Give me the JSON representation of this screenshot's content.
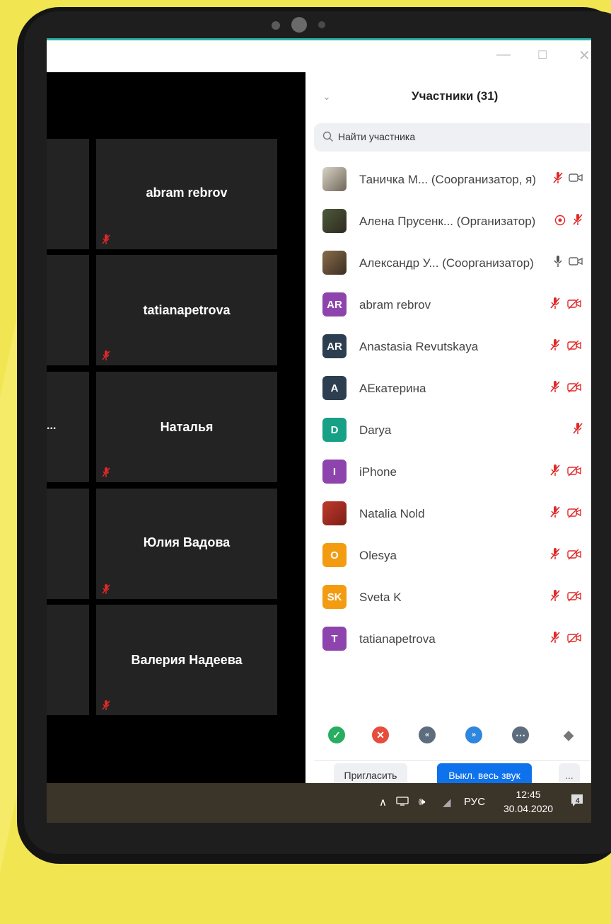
{
  "panel": {
    "title": "Участники (31)",
    "search_placeholder": "Найти участника"
  },
  "video_tiles": [
    {
      "name": "abram rebrov"
    },
    {
      "name": "tatianapetrova"
    },
    {
      "name": "Наталья"
    },
    {
      "name": "Юлия Вадова"
    },
    {
      "name": "Валерия Надеева"
    }
  ],
  "cut_off_text": "...",
  "participants": [
    {
      "name": "Таничка М...",
      "role": "(Соорганизатор, я)",
      "avatar": "photo"
    },
    {
      "name": "Алена Прусенк...",
      "role": "(Организатор)",
      "avatar": "photo"
    },
    {
      "name": "Александр У...",
      "role": "(Соорганизатор)",
      "avatar": "photo"
    },
    {
      "name": "abram rebrov",
      "role": "",
      "avatar": "AR",
      "color": "#8e44ad"
    },
    {
      "name": "Anastasia Revutskaya",
      "role": "",
      "avatar": "AR",
      "color": "#2c3e50"
    },
    {
      "name": "AЕкатерина",
      "role": "",
      "avatar": "A",
      "color": "#2c3e50"
    },
    {
      "name": "Darya",
      "role": "",
      "avatar": "D",
      "color": "#16a085"
    },
    {
      "name": "iPhone",
      "role": "",
      "avatar": "I",
      "color": "#8e44ad"
    },
    {
      "name": "Natalia Nold",
      "role": "",
      "avatar": "photo"
    },
    {
      "name": "Olesya",
      "role": "",
      "avatar": "O",
      "color": "#f39c12"
    },
    {
      "name": "Sveta K",
      "role": "",
      "avatar": "SK",
      "color": "#f39c12"
    },
    {
      "name": "tatianapetrova",
      "role": "",
      "avatar": "T",
      "color": "#8e44ad"
    }
  ],
  "footer": {
    "invite": "Пригласить",
    "mute_all": "Выкл. весь звук",
    "more": "..."
  },
  "taskbar": {
    "lang": "РУС",
    "time": "12:45",
    "date": "30.04.2020",
    "notif_count": "4"
  },
  "colors": {
    "accent_blue": "#0e72ed",
    "mic_off_red": "#e02828",
    "background_yellow": "#f2e552"
  }
}
